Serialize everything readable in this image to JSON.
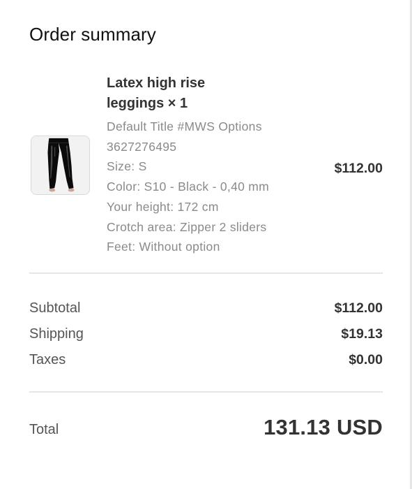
{
  "summary": {
    "title": "Order summary"
  },
  "line_item": {
    "image_alt": "leggings-product-image",
    "name": "Latex high rise leggings × 1",
    "details": [
      "Default Title #MWS Options",
      "3627276495",
      "Size: S",
      "Color: S10 - Black - 0,40 mm",
      "Your height: 172 cm",
      "Crotch area: Zipper 2 sliders",
      "Feet: Without option"
    ],
    "price": "$112.00"
  },
  "costs": {
    "subtotal_label": "Subtotal",
    "subtotal_value": "$112.00",
    "shipping_label": "Shipping",
    "shipping_value": "$19.13",
    "taxes_label": "Taxes",
    "taxes_value": "$0.00"
  },
  "total": {
    "label": "Total",
    "value": "131.13 USD"
  }
}
